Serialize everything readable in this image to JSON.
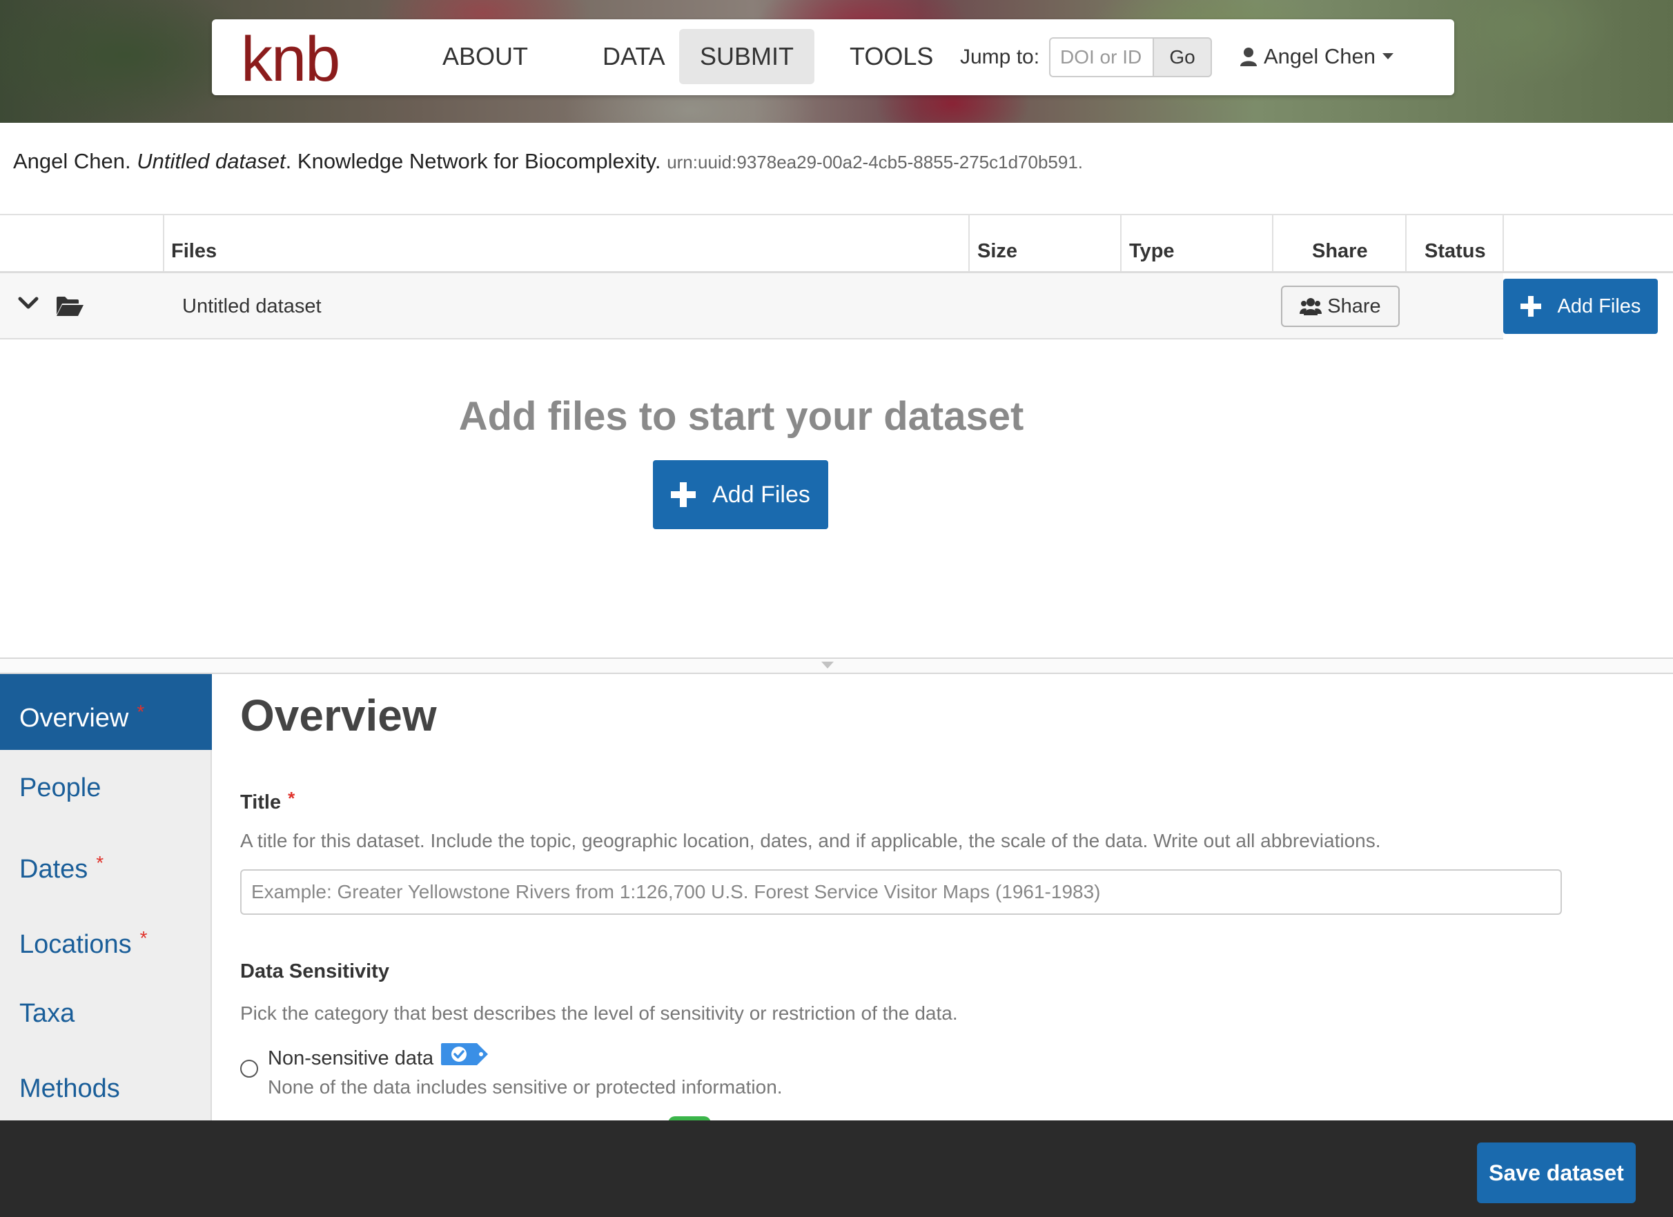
{
  "header": {
    "logo": "knb",
    "nav": [
      {
        "label": "ABOUT"
      },
      {
        "label": "DATA"
      },
      {
        "label": "SUBMIT",
        "active": true
      },
      {
        "label": "TOOLS"
      }
    ],
    "jump_label": "Jump to:",
    "jump_placeholder": "DOI or ID",
    "jump_go": "Go",
    "user_name": "Angel Chen"
  },
  "citation": {
    "author": "Angel Chen.",
    "title": "Untitled dataset",
    "repository": ". Knowledge Network for Biocomplexity.",
    "identifier": "urn:uuid:9378ea29-00a2-4cb5-8855-275c1d70b591."
  },
  "files_table": {
    "headers": {
      "files": "Files",
      "size": "Size",
      "type": "Type",
      "share": "Share",
      "status": "Status"
    },
    "row_name": "Untitled dataset",
    "share_button": "Share",
    "add_files_button": "Add Files"
  },
  "empty_state": {
    "title": "Add files to start your dataset",
    "button": "Add Files"
  },
  "sidebar": {
    "items": [
      {
        "label": "Overview",
        "required": "*"
      },
      {
        "label": "People"
      },
      {
        "label": "Dates",
        "required": "*"
      },
      {
        "label": "Locations",
        "required": "*"
      },
      {
        "label": "Taxa"
      },
      {
        "label": "Methods"
      }
    ]
  },
  "form": {
    "section_title": "Overview",
    "title_label": "Title",
    "title_required": "*",
    "title_help": "A title for this dataset. Include the topic, geographic location, dates, and if applicable, the scale of the data. Write out all abbreviations.",
    "title_placeholder": "Example: Greater Yellowstone Rivers from 1:126,700 U.S. Forest Service Visitor Maps (1961-1983)",
    "sensitivity_label": "Data Sensitivity",
    "sensitivity_help": "Pick the category that best describes the level of sensitivity or restriction of the data.",
    "option_label": "Non-sensitive data",
    "option_desc": "None of the data includes sensitive or protected information."
  },
  "footer": {
    "save_button": "Save dataset"
  },
  "colors": {
    "primary": "#1a6aae",
    "sidebar_active": "#1a5e99",
    "required": "#e0322b",
    "logo": "#8b1c1c",
    "footer_bg": "#2b2b2b"
  }
}
